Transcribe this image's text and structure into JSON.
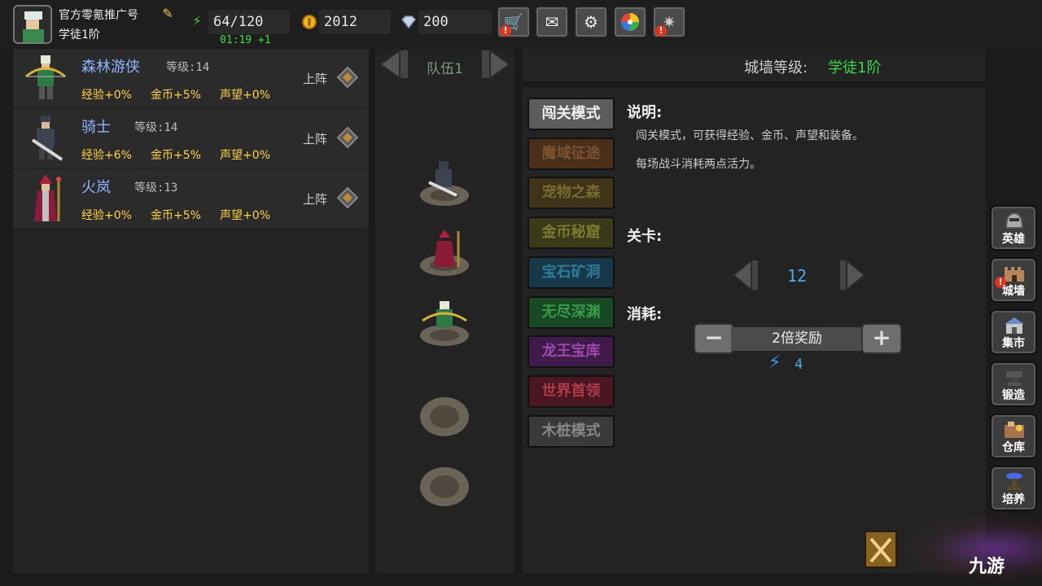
{
  "player": {
    "name": "官方零氪推广号",
    "rank": "学徒1阶"
  },
  "stats": {
    "energy": "64/120",
    "energy_timer": "01:19 +1",
    "gold": "2012",
    "diamond": "200"
  },
  "top_buttons": [
    {
      "icon": "shop-cart-icon",
      "alert": true
    },
    {
      "icon": "mail-icon",
      "alert": false
    },
    {
      "icon": "settings-gear-icon",
      "alert": false
    },
    {
      "icon": "prize-wheel-icon",
      "alert": false
    },
    {
      "icon": "fireworks-icon",
      "alert": true
    }
  ],
  "heroes": [
    {
      "name": "森林游侠",
      "level_text": "等级:14",
      "bonus_exp": "经验+0%",
      "bonus_gold": "金币+5%",
      "bonus_rep": "声望+0%",
      "deploy": "上阵"
    },
    {
      "name": "骑士",
      "level_text": "等级:14",
      "bonus_exp": "经验+6%",
      "bonus_gold": "金币+5%",
      "bonus_rep": "声望+0%",
      "deploy": "上阵"
    },
    {
      "name": "火岚",
      "level_text": "等级:13",
      "bonus_exp": "经验+0%",
      "bonus_gold": "金币+5%",
      "bonus_rep": "声望+0%",
      "deploy": "上阵"
    }
  ],
  "team": {
    "label": "队伍1"
  },
  "wall": {
    "label": "城墙等级:",
    "value": "学徒1阶"
  },
  "modes": [
    {
      "label": "闯关模式",
      "bg": "#5c5c5c",
      "fg": "#f0f0f0"
    },
    {
      "label": "魔域征途",
      "bg": "#4a2e1c",
      "fg": "#7a5230"
    },
    {
      "label": "宠物之森",
      "bg": "#3f3418",
      "fg": "#7a6a30"
    },
    {
      "label": "金币秘窟",
      "bg": "#3a3a1a",
      "fg": "#7d7a2e"
    },
    {
      "label": "宝石矿洞",
      "bg": "#163848",
      "fg": "#2e7a98"
    },
    {
      "label": "无尽深渊",
      "bg": "#174a22",
      "fg": "#3a9a4a"
    },
    {
      "label": "龙王宝库",
      "bg": "#401a4a",
      "fg": "#9a4aaa"
    },
    {
      "label": "世界首领",
      "bg": "#4a1622",
      "fg": "#b03a4a"
    },
    {
      "label": "木桩模式",
      "bg": "#3a3a3a",
      "fg": "#888888"
    }
  ],
  "info": {
    "desc_title": "说明:",
    "desc_line1": "闯关模式，可获得经验、金币、声望和装备。",
    "desc_line2": "每场战斗消耗两点活力。",
    "stage_title": "关卡:",
    "stage_value": "12",
    "cost_title": "消耗:",
    "multiplier": "2倍奖励",
    "cost_value": "4"
  },
  "side_menu": [
    {
      "label": "英雄",
      "alert": false
    },
    {
      "label": "城墙",
      "alert": true
    },
    {
      "label": "集市",
      "alert": false
    },
    {
      "label": "锻造",
      "alert": false
    },
    {
      "label": "仓库",
      "alert": false
    },
    {
      "label": "培养",
      "alert": false
    }
  ],
  "watermark": "九游"
}
